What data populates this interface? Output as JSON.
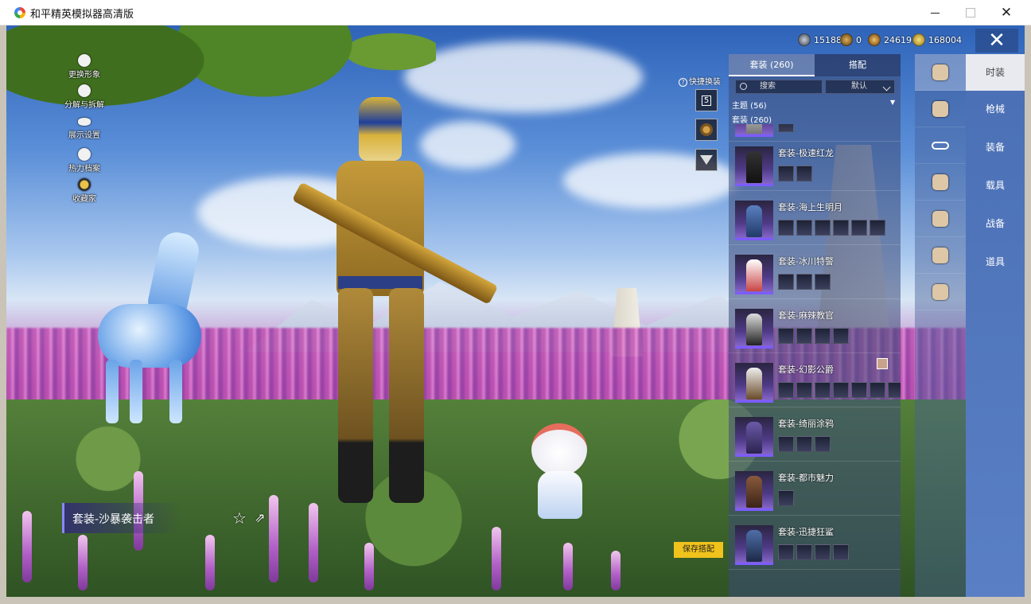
{
  "window": {
    "title": "和平精英模拟器高清版"
  },
  "currency": [
    {
      "icon": "silver-coin-icon",
      "value": "15188"
    },
    {
      "icon": "bronze-coin-icon",
      "value": "0"
    },
    {
      "icon": "gold-coin-icon",
      "value": "24619"
    },
    {
      "icon": "premium-coin-icon",
      "value": "168004"
    }
  ],
  "left_menu": [
    {
      "label": "更换形象",
      "icon": "person-icon"
    },
    {
      "label": "分解与拆解",
      "icon": "puzzle-icon"
    },
    {
      "label": "展示设置",
      "icon": "eye-icon"
    },
    {
      "label": "热力档案",
      "icon": "flame-icon"
    },
    {
      "label": "收藏家",
      "icon": "badge-icon"
    }
  ],
  "quick_switch": {
    "label": "快捷换装",
    "slot_number": "5"
  },
  "current_outfit": {
    "name": "套装-沙暴袭击者"
  },
  "list_panel": {
    "tabs": [
      {
        "label": "套装 (260)",
        "active": true
      },
      {
        "label": "搭配",
        "active": false
      }
    ],
    "search_placeholder": "搜索",
    "sort_value": "默认",
    "filter_theme": "主题 (56)",
    "filter_suits": "套装 (260)",
    "items": [
      {
        "name": "",
        "parts": 1
      },
      {
        "name": "套装-极速红龙",
        "parts": 2
      },
      {
        "name": "套装-海上生明月",
        "parts": 6
      },
      {
        "name": "套装-冰川特警",
        "parts": 3
      },
      {
        "name": "套装-麻辣教官",
        "parts": 4
      },
      {
        "name": "套装-幻影公爵",
        "parts": 7
      },
      {
        "name": "套装-绮丽涂鸦",
        "parts": 3
      },
      {
        "name": "套装-都市魅力",
        "parts": 1
      },
      {
        "name": "套装-迅捷狂鲨",
        "parts": 4
      }
    ]
  },
  "save_button": "保存搭配",
  "category_icons": [
    "outfit-icon",
    "helmet-icon",
    "glasses-icon",
    "top-icon",
    "jacket-icon",
    "pants-icon",
    "shoes-icon"
  ],
  "main_tabs": [
    {
      "label": "时装",
      "active": true
    },
    {
      "label": "枪械",
      "active": false
    },
    {
      "label": "装备",
      "active": false
    },
    {
      "label": "载具",
      "active": false
    },
    {
      "label": "战备",
      "active": false
    },
    {
      "label": "道具",
      "active": false
    }
  ]
}
